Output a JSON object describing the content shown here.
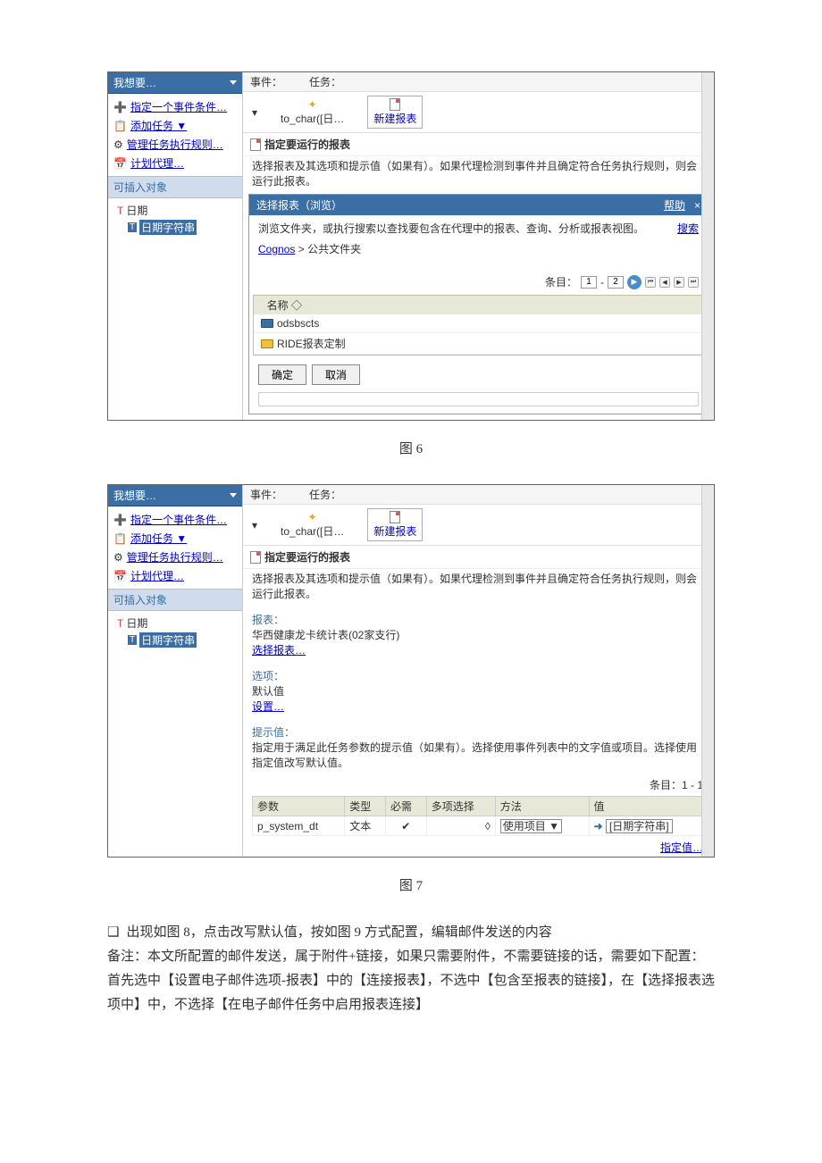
{
  "sidebar": {
    "header": "我想要…",
    "items": [
      {
        "icon": "condition",
        "label": "指定一个事件条件…"
      },
      {
        "icon": "task",
        "label": "添加任务 ▼"
      },
      {
        "icon": "rules",
        "label": "管理任务执行规则…"
      },
      {
        "icon": "agent",
        "label": "计划代理…"
      }
    ],
    "insertHeader": "可插入对象",
    "tree": [
      {
        "icon": "date",
        "label": "日期"
      },
      {
        "icon": "datestr",
        "label": "日期字符串"
      }
    ]
  },
  "toolbar": {
    "eventLabel": "事件：",
    "taskLabel": "任务：",
    "eventBtn": "to_char([日…",
    "newReport": "新建报表"
  },
  "panel1": {
    "title": "指定要运行的报表",
    "hint": "选择报表及其选项和提示值（如果有）。如果代理检测到事件并且确定符合任务执行规则，则会运行此报表。"
  },
  "dialog": {
    "title": "选择报表（浏览）",
    "help": "帮助",
    "desc": "浏览文件夹，或执行搜索以查找要包含在代理中的报表、查询、分析或报表视图。",
    "search": "搜索",
    "bcRoot": "Cognos",
    "bcCur": "公共文件夹",
    "pagerLabel": "条目：",
    "pageFrom": "1",
    "pageTo": "2",
    "colName": "名称 ◇",
    "rows": [
      {
        "icon": "fld-blue",
        "label": "odsbscts"
      },
      {
        "icon": "folder",
        "label": "RIDE报表定制"
      }
    ],
    "ok": "确定",
    "cancel": "取消"
  },
  "panel2": {
    "title": "指定要运行的报表",
    "hint": "选择报表及其选项和提示值（如果有）。如果代理检测到事件并且确定符合任务执行规则，则会运行此报表。",
    "reportLabel": "报表：",
    "reportName": "华西健康龙卡统计表(02家支行)",
    "selectReport": "选择报表…",
    "optionsLabel": "选项：",
    "optionsVal": "默认值",
    "setOpt": "设置…",
    "promptLabel": "提示值：",
    "promptHint": "指定用于满足此任务参数的提示值（如果有）。选择使用事件列表中的文字值或项目。选择使用指定值改写默认值。",
    "countLabel": "条目：1 - 1",
    "th": [
      "参数",
      "类型",
      "必需",
      "多项选择",
      "方法",
      "值"
    ],
    "row": {
      "param": "p_system_dt",
      "type": "文本",
      "required": "✔",
      "multi": "◊",
      "method": "使用项目 ▼",
      "value": "[日期字符串]"
    },
    "specify": "指定值…"
  },
  "fig6": "图 6",
  "fig7": "图 7",
  "text": {
    "line1": "出现如图 8，点击改写默认值，按如图 9 方式配置，编辑邮件发送的内容",
    "line2": "备注：本文所配置的邮件发送，属于附件+链接，如果只需要附件，不需要链接的话，需要如下配置：首先选中【设置电子邮件选项-报表】中的【连接报表】，不选中【包含至报表的链接】，在【选择报表选项中】中，不选择【在电子邮件任务中启用报表连接】"
  }
}
